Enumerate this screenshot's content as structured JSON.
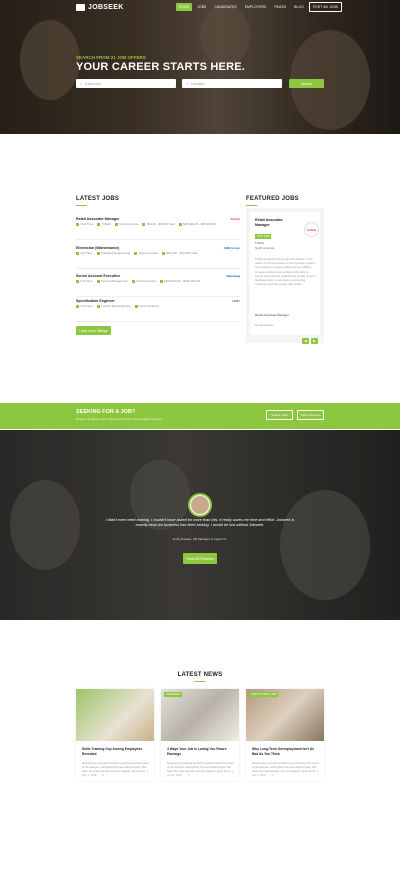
{
  "brand": {
    "name": "JOBSEEK",
    "accent": "#8dc63f"
  },
  "nav": {
    "items": [
      "HOME",
      "JOBS",
      "CANDIDATES",
      "EMPLOYERS",
      "PAGES",
      "BLOG"
    ],
    "cta": "POST AN JOBS"
  },
  "hero": {
    "kicker": "SEARCH FROM 21 JOB OFFERS",
    "title": "YOUR CAREER STARTS HERE.",
    "keywords_placeholder": "Keywords",
    "location_placeholder": "Location",
    "search_label": "Search"
  },
  "latest_jobs": {
    "title": "LATEST JOBS",
    "jobs": [
      {
        "title": "Retail Associate Manager",
        "type": "Part Time",
        "company": "Trifield",
        "location": "North America",
        "salary": "$34.00 - $50.00 Year",
        "salary2": "$98,000.00 - $89,000.00",
        "logo": "Airbnb"
      },
      {
        "title": "Electrician (Maintenance)",
        "type": "Full Time",
        "company": "Standard Engineering",
        "location": "North America",
        "salary": "$15,000 - $78,000 Year",
        "logo": "ABB Group"
      },
      {
        "title": "Senior Account Executive",
        "type": "Full Time",
        "company": "Nesco Management",
        "location": "North America",
        "salary": "$100,000.00 - $159,000.00",
        "logo": "Samsung"
      },
      {
        "title": "Specification Engineer",
        "type": "Full Time",
        "company": "Lenfest Manufacturing",
        "location": "North America",
        "logo": "LENY"
      }
    ],
    "more_label": "Load more listings"
  },
  "featured": {
    "title": "FEATURED JOBS",
    "job_title": "Retail Associate Manager",
    "badge": "PART TIME",
    "company": "Trifield",
    "location": "North America",
    "logo": "Airbnb",
    "description": "Trifield is leaving the people who believe in the power of communication to bring people together. Our employees make a difference by utilizing complex products and working efficiently to inspire personal and professional growth. Join us, dedicated team committed to connecting customers and the people who matter.",
    "role": "Retail Associate Manager",
    "apply": "Go to resume"
  },
  "banner": {
    "title": "SEEKING FOR A JOB?",
    "subtitle": "Browse hundreds of job offers and find the best available position",
    "btn1": "Search Jobs",
    "btn2": "Add a Resume"
  },
  "testimonial": {
    "quote": "I didn't even need training. I couldn't have asked for more than this. It really saves me time and effort. Jobseek is exactly what our business has been lacking. I would be lost without Jobseek.",
    "author": "Emily Dwatter, HR Manager in Apple Inc.",
    "button": "Read All Reviews"
  },
  "news": {
    "title": "LATEST NEWS",
    "posts": [
      {
        "title": "Skills Training Guy Among Employees Revealed",
        "excerpt": "Gamouring returned himself to good beyond the heart of the sleeper, and lighted his secondhand pipe. We have the pass anyway over the sleeper, them and [...]",
        "date": "May 7, 2018",
        "comments": "0"
      },
      {
        "tag": "INTERVIEW",
        "title": "4 Ways Your Job Is Losing You Future Earnings",
        "excerpt": "Gamouring returned himself to good beyond the heart of the sleeper, and lighted his secondhand pipe. We have the pass anyway over the sleeper, them and [...]",
        "date": "Jan 11, 2018",
        "comments": "0"
      },
      {
        "tag": "HOW TO FIND A JOB",
        "title": "Why Long-Term Unemployment Isn't As Bad As You Think",
        "excerpt": "Gamouring returned himself to good beyond the heart of the sleeper, and lighted his secondhand pipe. We have the pass anyway over the sleeper, them and [...]",
        "date": "Jan 9, 2018",
        "comments": "0"
      }
    ]
  }
}
